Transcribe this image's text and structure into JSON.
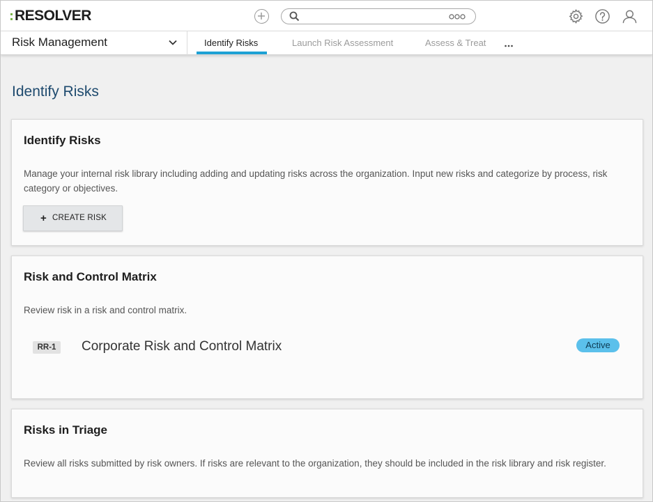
{
  "header": {
    "logo_text": "RESOLVER",
    "search": {
      "value": "",
      "placeholder": ""
    },
    "icons": [
      "add-circle-icon",
      "search-icon",
      "more-options-icon",
      "gear-icon",
      "help-icon",
      "user-icon"
    ]
  },
  "nav": {
    "app_name": "Risk Management",
    "tabs": [
      {
        "label": "Identify Risks",
        "active": true
      },
      {
        "label": "Launch Risk Assessment",
        "active": false
      },
      {
        "label": "Assess & Treat",
        "active": false
      }
    ]
  },
  "main": {
    "page_title": "Identify Risks",
    "cards": [
      {
        "title": "Identify Risks",
        "description": "Manage your internal risk library including adding and updating risks across the organization. Input new risks and categorize by process, risk category or objectives.",
        "button_label": "CREATE RISK"
      },
      {
        "title": "Risk and Control Matrix",
        "description": "Review risk in a risk and control matrix.",
        "items": [
          {
            "id": "RR-1",
            "name": "Corporate Risk and Control Matrix",
            "status": "Active"
          }
        ]
      },
      {
        "title": "Risks in Triage",
        "description": "Review all risks submitted by risk owners. If risks are relevant to the organization, they should be included in the risk library and risk register."
      }
    ]
  },
  "colors": {
    "accent_tab": "#1ea1d4",
    "logo_accent": "#7ab648",
    "title_blue": "#1e4a6e",
    "status_active": "#5bc0eb"
  }
}
